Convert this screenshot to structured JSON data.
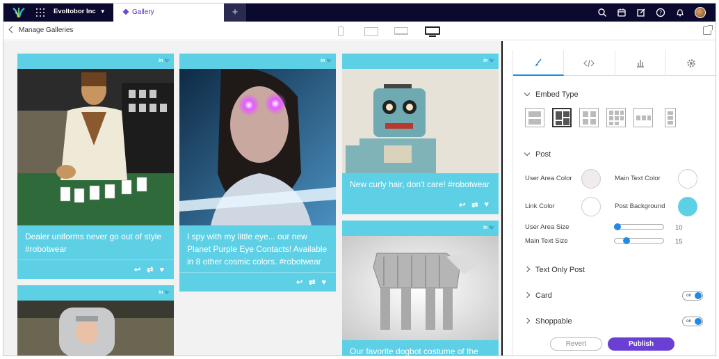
{
  "topbar": {
    "org_name": "Evoltobor Inc",
    "active_tab": "Gallery",
    "new_tab_label": "+"
  },
  "subbar": {
    "back_label": "Manage Galleries"
  },
  "social_icons": "in 🐦",
  "posts": [
    {
      "caption": "Dealer uniforms never go out of style #robotwear",
      "image": "robot-dealer-casino"
    },
    {
      "caption": "I spy with my little eye... our new Planet Purple Eye Contacts! Available in 8 other cosmic colors. #robotwear",
      "image": "woman-purple-eyes"
    },
    {
      "caption": "New curly hair, don't care! #robotwear",
      "image": "toy-robot"
    },
    {
      "caption": "",
      "image": "kid-robot-costume"
    },
    {
      "caption": "Our favorite dogbot costume of the",
      "image": "dog-walker-costume"
    }
  ],
  "actions": {
    "reply": "↩",
    "retweet": "⇄",
    "like": "♥"
  },
  "panel": {
    "tabs": [
      "brush-icon",
      "code-icon",
      "chart-icon",
      "gear-icon"
    ],
    "embed_type_label": "Embed Type",
    "post_label": "Post",
    "user_area_color_label": "User Area Color",
    "main_text_color_label": "Main Text Color",
    "link_color_label": "Link Color",
    "post_background_label": "Post Background",
    "user_area_size_label": "User Area Size",
    "user_area_size_value": "10",
    "main_text_size_label": "Main Text Size",
    "main_text_size_value": "15",
    "text_only_post_label": "Text Only Post",
    "card_label": "Card",
    "card_toggle": "on",
    "shoppable_label": "Shoppable",
    "shoppable_toggle": "on",
    "revert_label": "Revert",
    "publish_label": "Publish"
  },
  "colors": {
    "accent": "#5ed0e6",
    "user_area_color": "#f1ecec",
    "main_text_color": "#ffffff",
    "link_color": "#ffffff",
    "post_background": "#5ed0e6",
    "publish": "#6a3fd3",
    "topbar": "#0b0a2e"
  }
}
